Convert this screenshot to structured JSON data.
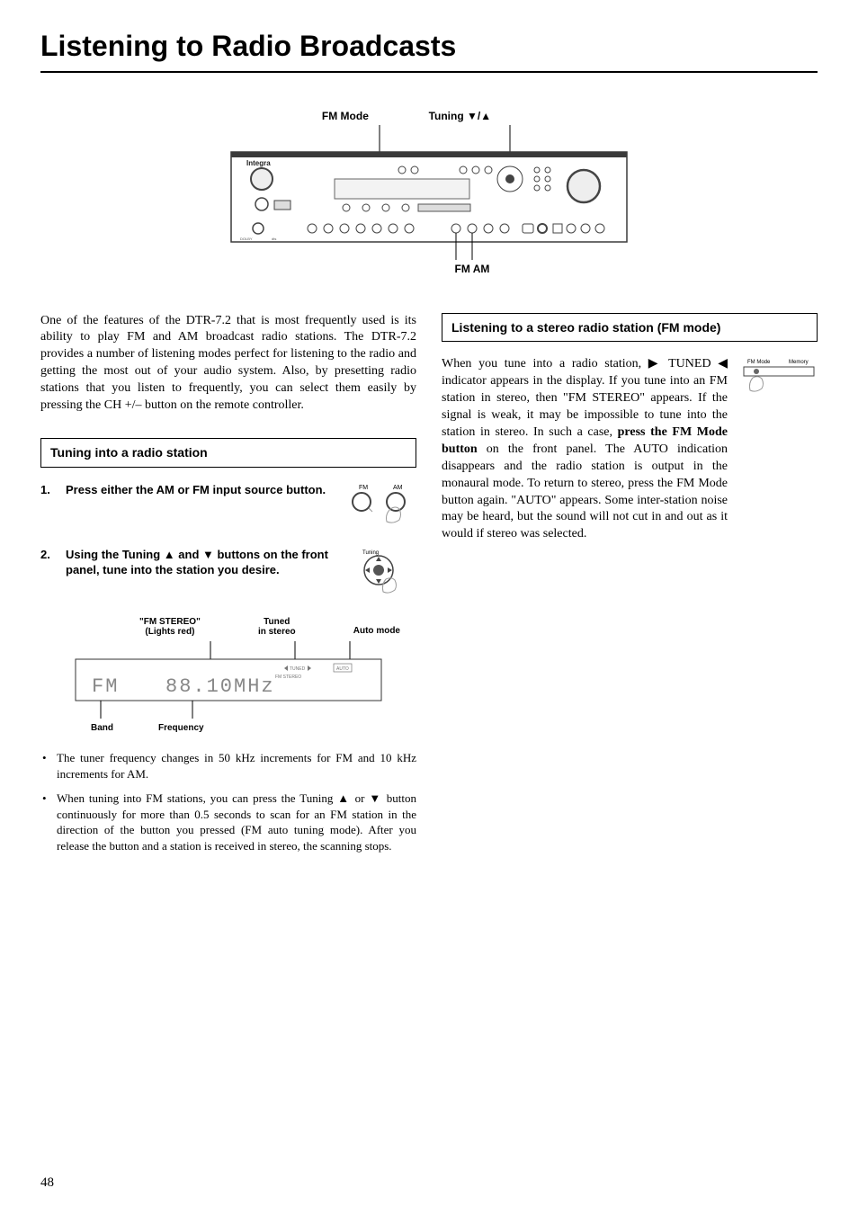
{
  "page_title": "Listening to Radio Broadcasts",
  "diagram": {
    "fm_mode_label": "FM Mode",
    "tuning_label": "Tuning ▼/▲",
    "bottom_label": "FM  AM"
  },
  "intro": "One of the features of the DTR-7.2 that is most frequently used is its ability to play FM and AM broadcast radio stations. The DTR-7.2 provides a number of listening modes perfect for listening to the radio and getting the most out of your audio system. Also, by presetting radio stations that you listen to frequently, you can select them easily by pressing the CH +/– button on the remote controller.",
  "tuning_section_title": "Tuning into a radio station",
  "step1_num": "1.",
  "step1_text": "Press either the AM or FM input source button.",
  "step1_icon_fm": "FM",
  "step1_icon_am": "AM",
  "step2_num": "2.",
  "step2_text": "Using the Tuning ▲ and ▼ buttons on the front panel, tune into the station you desire.",
  "step2_icon_tuning": "Tuning",
  "display_labels": {
    "fm_stereo": "\"FM STEREO\"",
    "lights_red": "(Lights red)",
    "tuned": "Tuned",
    "in_stereo": "in stereo",
    "auto_mode": "Auto mode",
    "band": "Band",
    "frequency": "Frequency",
    "lcd_band": "FM",
    "lcd_freq": "88.10MHz",
    "lcd_tuned": "TUNED",
    "lcd_fmstereo": "FM STEREO",
    "lcd_auto": "AUTO"
  },
  "notes": [
    "The tuner frequency changes in 50 kHz increments for FM and 10 kHz increments for AM.",
    "When tuning into FM stations, you can press the Tuning ▲ or ▼ button continuously for more than 0.5 seconds to scan for an FM station in the direction of the button you pressed (FM auto tuning mode). After you release the button and a station is received in stereo, the scanning stops."
  ],
  "stereo_section_title": "Listening to a stereo radio station (FM mode)",
  "stereo_body_pre": "When you tune into a radio station, ▶ TUNED ◀ indicator appears in the display. If you tune into an FM station in stereo, then \"FM STEREO\" appears. If the signal is weak, it may be impossible to tune into the station in stereo. In such a case, ",
  "stereo_body_bold": "press the FM Mode button",
  "stereo_body_post": " on the front panel. The AUTO indication disappears and the radio station is output in the monaural mode. To return to stereo, press the FM Mode button again. \"AUTO\" appears. Some inter-station noise may be heard, but the sound will not cut in and out as it would if stereo was selected.",
  "fmmode_icon_fm": "FM Mode",
  "fmmode_icon_mem": "Memory",
  "page_number": "48"
}
